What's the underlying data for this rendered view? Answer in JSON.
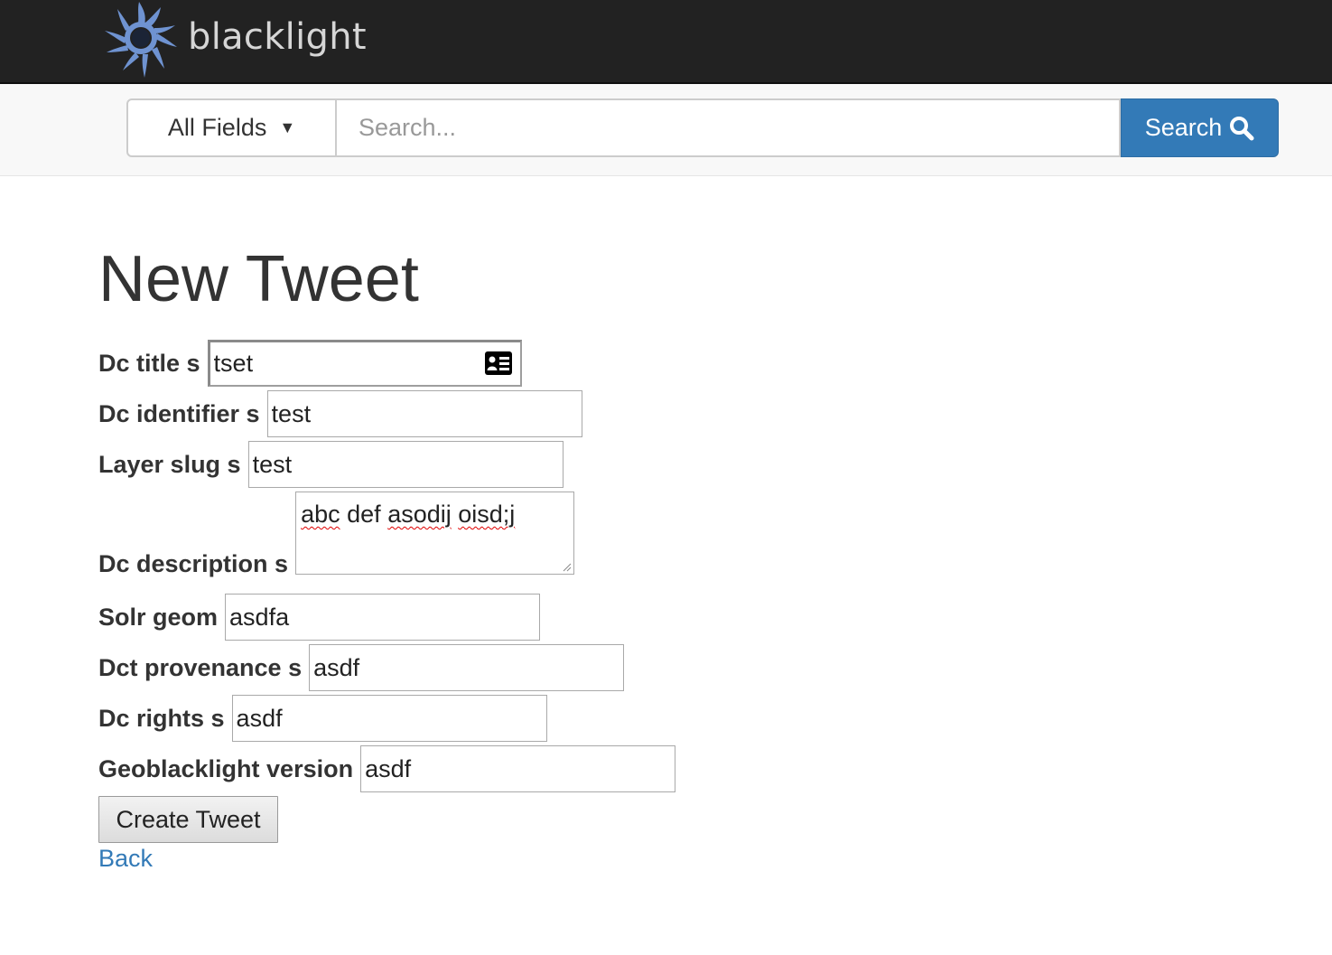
{
  "brand": {
    "name": "blacklight"
  },
  "search": {
    "field_selector": "All Fields",
    "placeholder": "Search...",
    "button_label": "Search"
  },
  "page": {
    "title": "New Tweet"
  },
  "form": {
    "fields": [
      {
        "label": "Dc title s",
        "value": "tset"
      },
      {
        "label": "Dc identifier s",
        "value": "test"
      },
      {
        "label": "Layer slug s",
        "value": "test"
      },
      {
        "label": "Dc description s",
        "value_words": [
          "abc",
          "def",
          "asodij",
          "oisd;j"
        ]
      },
      {
        "label": "Solr geom",
        "value": "asdfa"
      },
      {
        "label": "Dct provenance s",
        "value": "asdf"
      },
      {
        "label": "Dc rights s",
        "value": "asdf"
      },
      {
        "label": "Geoblacklight version",
        "value": "asdf"
      }
    ],
    "submit_label": "Create Tweet",
    "back_label": "Back"
  },
  "colors": {
    "primary": "#337ab7",
    "navbar": "#222222",
    "logo_blue": "#6f93d1"
  }
}
